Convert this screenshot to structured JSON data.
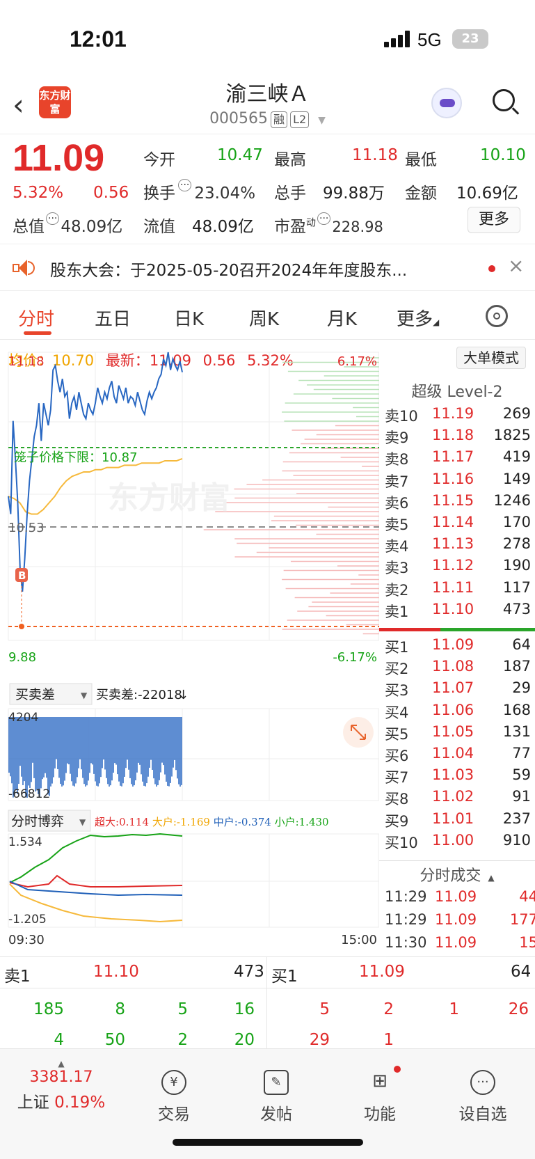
{
  "status_bar": {
    "time": "12:01",
    "network": "5G",
    "battery": "23"
  },
  "header": {
    "logo_text": "东方财富",
    "stock_name": "渝三峡Ａ",
    "stock_code": "000565",
    "tags": [
      "融",
      "L2"
    ]
  },
  "quote": {
    "price": "11.09",
    "change_pct": "5.32%",
    "change": "0.56",
    "open_label": "今开",
    "open": "10.47",
    "high_label": "最高",
    "high": "11.18",
    "low_label": "最低",
    "low": "10.10",
    "turnover_label": "换手",
    "turnover": "23.04%",
    "volume_label": "总手",
    "volume": "99.88万",
    "amount_label": "金额",
    "amount": "10.69亿",
    "mktcap_label": "总值",
    "mktcap": "48.09亿",
    "float_label": "流值",
    "float": "48.09亿",
    "pe_label": "市盈",
    "pe_sup": "动",
    "pe": "228.98",
    "more": "更多"
  },
  "notice": {
    "text": "股东大会：于2025-05-20召开2024年年度股东..."
  },
  "tabs": [
    "分时",
    "五日",
    "日K",
    "周K",
    "月K",
    "更多"
  ],
  "chart_info": {
    "avg_label": "均价：",
    "avg": "10.70",
    "latest_label": "最新：",
    "latest": "11.09",
    "latest_chg": "0.56",
    "latest_pct": "5.32%",
    "mode_btn": "大单模式"
  },
  "chart_data": {
    "type": "line",
    "y_top": "11.18",
    "y_bottom": "9.88",
    "y_mid": "10.53",
    "pct_top": "6.17%",
    "pct_bottom": "-6.17%",
    "cage_label": "笼子价格下限：10.87",
    "x_start": "09:30",
    "x_end": "15:00",
    "watermark": "东方财富",
    "buy_marker": "B",
    "price_series": [
      10.53,
      10.45,
      10.87,
      10.7,
      10.5,
      10.2,
      10.1,
      10.25,
      10.45,
      10.6,
      10.7,
      10.8,
      10.85,
      10.95,
      10.78,
      10.95,
      10.9,
      10.85,
      10.92,
      11.1,
      11.12,
      11.05,
      11.0,
      11.06,
      10.98,
      11.0,
      10.88,
      10.95,
      10.98,
      10.92,
      11.0,
      10.95,
      10.9,
      10.88,
      10.95,
      10.92,
      10.9,
      10.95,
      11.02,
      10.98,
      10.95,
      11.0,
      10.97,
      11.02,
      11.05,
      10.98,
      10.95,
      11.03,
      11.0,
      10.97,
      11.02,
      10.95,
      10.98,
      10.97,
      10.94,
      11.0,
      10.96,
      10.92,
      10.9,
      10.96,
      11.0,
      10.97,
      11.0,
      11.02,
      11.06,
      11.08,
      11.15,
      11.12,
      11.18,
      11.1,
      11.15,
      11.12,
      11.1,
      11.14,
      11.09
    ],
    "avg_series": [
      10.53,
      10.52,
      10.5,
      10.46,
      10.45,
      10.45,
      10.47,
      10.5,
      10.53,
      10.57,
      10.6,
      10.62,
      10.63,
      10.64,
      10.64,
      10.65,
      10.65,
      10.66,
      10.66,
      10.66,
      10.67,
      10.67,
      10.67,
      10.68,
      10.68,
      10.68,
      10.68,
      10.69,
      10.69,
      10.69,
      10.7
    ],
    "sub1": {
      "selector": "买卖差",
      "label": "买卖差:-22018",
      "max": "4204",
      "min": "-66812"
    },
    "sub2": {
      "selector": "分时博弈",
      "legend": [
        {
          "name": "超大",
          "value": "0.114",
          "color": "#e02a2a"
        },
        {
          "name": "大户",
          "value": "-1.169",
          "color": "#f0a500"
        },
        {
          "name": "中户",
          "value": "-0.374",
          "color": "#2060b8"
        },
        {
          "name": "小户",
          "value": "1.430",
          "color": "#17a317"
        }
      ],
      "max": "1.534",
      "min": "-1.205"
    }
  },
  "orderbook": {
    "title": "超级 Level-2",
    "sells": [
      {
        "label": "卖10",
        "price": "11.19",
        "vol": "269",
        "dot": "#cfcfcf"
      },
      {
        "label": "卖9",
        "price": "11.18",
        "vol": "1825",
        "dot": "#2060b8"
      },
      {
        "label": "卖8",
        "price": "11.17",
        "vol": "419",
        "dot": "#cfcfcf"
      },
      {
        "label": "卖7",
        "price": "11.16",
        "vol": "149",
        "dot": "#cfcfcf"
      },
      {
        "label": "卖6",
        "price": "11.15",
        "vol": "1246",
        "dot": "#2060b8"
      },
      {
        "label": "卖5",
        "price": "11.14",
        "vol": "170",
        "dot": "#cfcfcf"
      },
      {
        "label": "卖4",
        "price": "11.13",
        "vol": "278",
        "dot": "#2060b8"
      },
      {
        "label": "卖3",
        "price": "11.12",
        "vol": "190",
        "dot": "#cfcfcf"
      },
      {
        "label": "卖2",
        "price": "11.11",
        "vol": "117",
        "dot": "#cfcfcf"
      },
      {
        "label": "卖1",
        "price": "11.10",
        "vol": "473",
        "dot": "#2060b8"
      }
    ],
    "buys": [
      {
        "label": "买1",
        "price": "11.09",
        "vol": "64",
        "dot": "#cfcfcf"
      },
      {
        "label": "买2",
        "price": "11.08",
        "vol": "187",
        "dot": "#f06020"
      },
      {
        "label": "买3",
        "price": "11.07",
        "vol": "29",
        "dot": "#cfcfcf"
      },
      {
        "label": "买4",
        "price": "11.06",
        "vol": "168",
        "dot": "#cfcfcf"
      },
      {
        "label": "买5",
        "price": "11.05",
        "vol": "131",
        "dot": "#cfcfcf"
      },
      {
        "label": "买6",
        "price": "11.04",
        "vol": "77",
        "dot": "#cfcfcf"
      },
      {
        "label": "买7",
        "price": "11.03",
        "vol": "59",
        "dot": "#cfcfcf"
      },
      {
        "label": "买8",
        "price": "11.02",
        "vol": "91",
        "dot": "#cfcfcf"
      },
      {
        "label": "买9",
        "price": "11.01",
        "vol": "237",
        "dot": "#cfcfcf"
      },
      {
        "label": "买10",
        "price": "11.00",
        "vol": "910",
        "dot": "#f06020"
      }
    ],
    "trades_title": "分时成交",
    "trades": [
      {
        "time": "11:29",
        "price": "11.09",
        "vol": "44"
      },
      {
        "time": "11:29",
        "price": "11.09",
        "vol": "177"
      },
      {
        "time": "11:30",
        "price": "11.09",
        "vol": "15"
      }
    ]
  },
  "queue": {
    "sell1_label": "卖1",
    "sell1_price": "11.10",
    "sell1_vol": "473",
    "buy1_label": "买1",
    "buy1_price": "11.09",
    "buy1_vol": "64",
    "sell_orders": [
      [
        "185",
        "8",
        "5",
        "16"
      ],
      [
        "4",
        "50",
        "2",
        "20"
      ]
    ],
    "buy_orders": [
      [
        "5",
        "2",
        "1",
        "26"
      ],
      [
        "29",
        "1",
        "",
        ""
      ]
    ]
  },
  "bottom_nav": {
    "index_value": "3381.17",
    "index_name": "上证",
    "index_pct": "0.19%",
    "items": [
      "交易",
      "发帖",
      "功能",
      "设自选"
    ]
  }
}
